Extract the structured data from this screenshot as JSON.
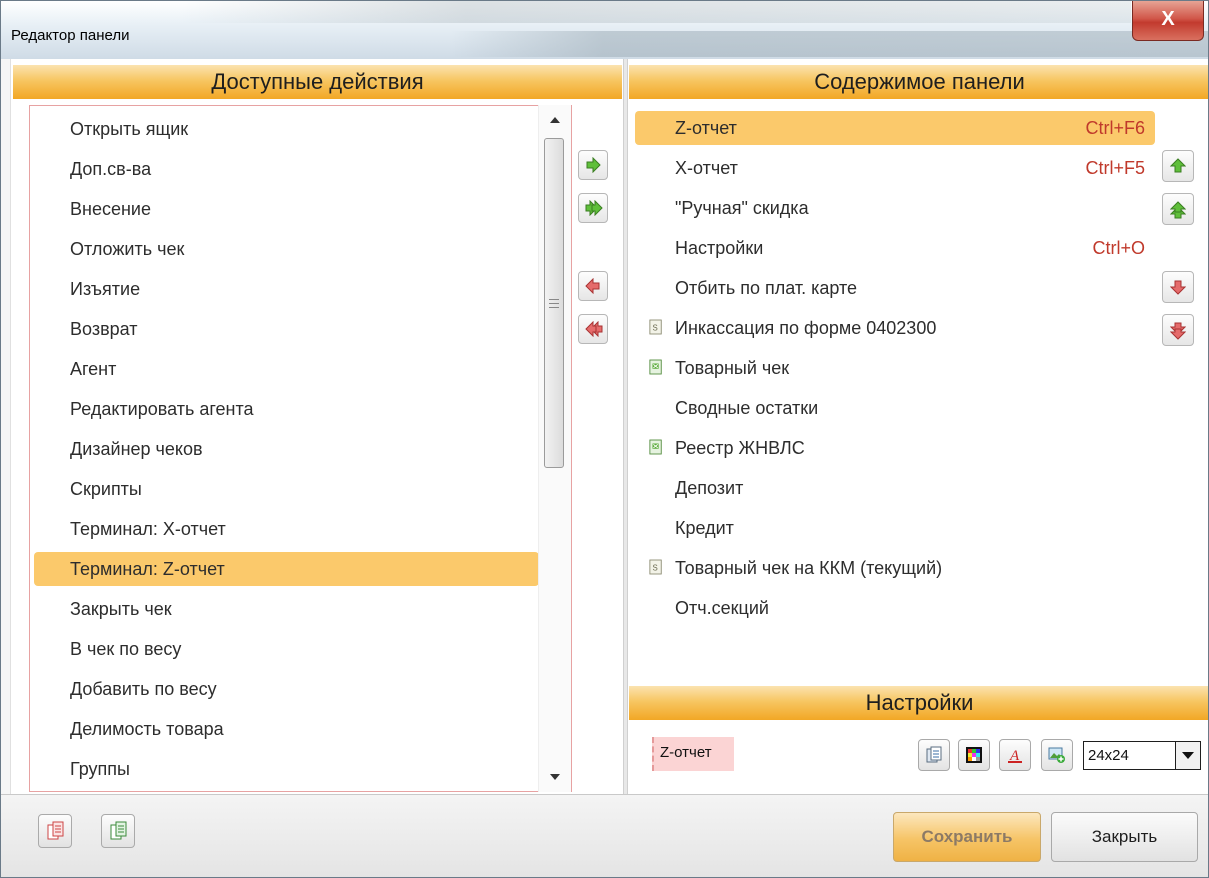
{
  "window": {
    "title": "Редактор панели",
    "close_glyph": "X"
  },
  "left_panel": {
    "header": "Доступные действия",
    "items": [
      "Открыть ящик",
      "Доп.св-ва",
      "Внесение",
      "Отложить чек",
      "Изъятие",
      "Возврат",
      "Агент",
      "Редактировать агента",
      "Дизайнер чеков",
      "Скрипты",
      "Терминал: X-отчет",
      "Терминал: Z-отчет",
      "Закрыть чек",
      "В чек по весу",
      "Добавить по весу",
      "Делимость товара",
      "Группы"
    ],
    "selected_index": 11
  },
  "right_panel": {
    "header": "Содержимое панели",
    "items": [
      {
        "label": "Z-отчет",
        "shortcut": "Ctrl+F6",
        "icon": ""
      },
      {
        "label": "X-отчет",
        "shortcut": "Ctrl+F5",
        "icon": ""
      },
      {
        "label": "\"Ручная\" скидка",
        "shortcut": "",
        "icon": ""
      },
      {
        "label": "Настройки",
        "shortcut": "Ctrl+O",
        "icon": ""
      },
      {
        "label": "Отбить по плат. карте",
        "shortcut": "",
        "icon": ""
      },
      {
        "label": "Инкассация по форме 0402300",
        "shortcut": "",
        "icon": "script-doc-icon"
      },
      {
        "label": "Товарный чек",
        "shortcut": "",
        "icon": "report-doc-icon"
      },
      {
        "label": "Сводные остатки",
        "shortcut": "",
        "icon": ""
      },
      {
        "label": "Реестр ЖНВЛС",
        "shortcut": "",
        "icon": "report-doc-icon"
      },
      {
        "label": "Депозит",
        "shortcut": "",
        "icon": ""
      },
      {
        "label": "Кредит",
        "shortcut": "",
        "icon": ""
      },
      {
        "label": "Товарный чек на ККМ (текущий)",
        "shortcut": "",
        "icon": "script-doc-icon"
      },
      {
        "label": "Отч.секций",
        "shortcut": "",
        "icon": ""
      }
    ],
    "selected_index": 0
  },
  "settings": {
    "header": "Настройки",
    "preview_label": "Z-отчет",
    "icon_size": "24x24"
  },
  "footer": {
    "save_label": "Сохранить",
    "close_label": "Закрыть"
  },
  "colors": {
    "accent": "#f6b33a",
    "selection": "#fbc96b",
    "shortcut_text": "#c0392b",
    "arrow_green": "#3aa83a",
    "arrow_red": "#d9534f"
  }
}
